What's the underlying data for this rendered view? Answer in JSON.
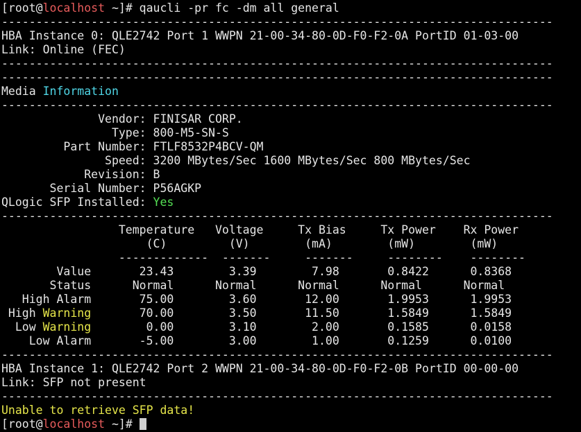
{
  "colors": {
    "background": "#000000",
    "text": "#e6e6e6",
    "host": "#e85c5c",
    "info": "#4fd6e6",
    "ok": "#55e055",
    "warn": "#e6e64a"
  },
  "lines": [
    [
      {
        "t": "[root@",
        "c": "w"
      },
      {
        "t": "localhost",
        "c": "red"
      },
      {
        "t": " ~]# qaucli -pr fc -dm all general",
        "c": "w"
      }
    ],
    [
      {
        "t": "--------------------------------------------------------------------------------",
        "c": "w"
      }
    ],
    [
      {
        "t": "HBA Instance 0: QLE2742 Port 1 WWPN 21-00-34-80-0D-F0-F2-0A PortID 01-03-00",
        "c": "w"
      }
    ],
    [
      {
        "t": "Link: Online (FEC)",
        "c": "w"
      }
    ],
    [
      {
        "t": "--------------------------------------------------------------------------------",
        "c": "w"
      }
    ],
    [
      {
        "t": "--------------------------------------------------------------------------------",
        "c": "w"
      }
    ],
    [
      {
        "t": "Media ",
        "c": "w"
      },
      {
        "t": "Information",
        "c": "cyan"
      }
    ],
    [
      {
        "t": "--------------------------------------------------------------------------------",
        "c": "w"
      }
    ],
    [
      {
        "t": "              Vendor: FINISAR CORP.",
        "c": "w"
      }
    ],
    [
      {
        "t": "                Type: 800-M5-SN-S",
        "c": "w"
      }
    ],
    [
      {
        "t": "         Part Number: FTLF8532P4BCV-QM",
        "c": "w"
      }
    ],
    [
      {
        "t": "               Speed: 3200 MBytes/Sec 1600 MBytes/Sec 800 MBytes/Sec",
        "c": "w"
      }
    ],
    [
      {
        "t": "            Revision: B",
        "c": "w"
      }
    ],
    [
      {
        "t": "       Serial Number: P56AGKP",
        "c": "w"
      }
    ],
    [
      {
        "t": "QLogic SFP Installed: ",
        "c": "w"
      },
      {
        "t": "Yes",
        "c": "green"
      }
    ],
    [
      {
        "t": "--------------------------------------------------------------------------------",
        "c": "w"
      }
    ],
    [
      {
        "t": "                 Temperature   Voltage     Tx Bias     Tx Power    Rx Power",
        "c": "w"
      }
    ],
    [
      {
        "t": "                     (C)         (V)        (mA)        (mW)        (mW)",
        "c": "w"
      }
    ],
    [
      {
        "t": "                 -------------  -------     -------     --------    --------",
        "c": "w"
      }
    ],
    [
      {
        "t": "        Value       23.43        3.39        7.98       0.8422      0.8368",
        "c": "w"
      }
    ],
    [
      {
        "t": "       Status      Normal      Normal      Normal      Normal      Normal",
        "c": "w"
      }
    ],
    [
      {
        "t": "   High Alarm       75.00        3.60       12.00       1.9953      1.9953",
        "c": "w"
      }
    ],
    [
      {
        "t": " High ",
        "c": "w"
      },
      {
        "t": "Warning",
        "c": "yellow"
      },
      {
        "t": "       70.00        3.50       11.50       1.5849      1.5849",
        "c": "w"
      }
    ],
    [
      {
        "t": "  Low ",
        "c": "w"
      },
      {
        "t": "Warning",
        "c": "yellow"
      },
      {
        "t": "        0.00        3.10        2.00       0.1585      0.0158",
        "c": "w"
      }
    ],
    [
      {
        "t": "    Low Alarm       -5.00        3.00        1.00       0.1259      0.0100",
        "c": "w"
      }
    ],
    [
      {
        "t": "--------------------------------------------------------------------------------",
        "c": "w"
      }
    ],
    [
      {
        "t": "HBA Instance 1: QLE2742 Port 2 WWPN 21-00-34-80-0D-F0-F2-0B PortID 00-00-00",
        "c": "w"
      }
    ],
    [
      {
        "t": "Link: SFP not present",
        "c": "w"
      }
    ],
    [
      {
        "t": "--------------------------------------------------------------------------------",
        "c": "w"
      }
    ],
    [
      {
        "t": "Unable to retrieve SFP data!",
        "c": "yellow"
      }
    ],
    [
      {
        "t": "[root@",
        "c": "w"
      },
      {
        "t": "localhost",
        "c": "red"
      },
      {
        "t": " ~]# ",
        "c": "w"
      }
    ]
  ]
}
